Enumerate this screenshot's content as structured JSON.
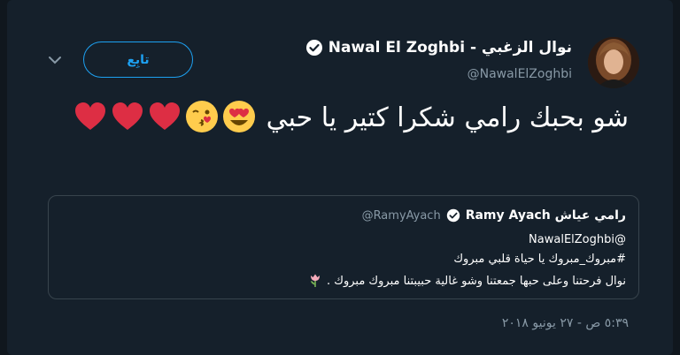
{
  "user": {
    "name": "Nawal El Zoghbi - نوال الزغبي",
    "handle": "@NawalElZoghbi",
    "verified": true
  },
  "follow_button": {
    "label": "تابِع"
  },
  "tweet": {
    "text": "شو بحبك رامي شكرا كتير يا حبي",
    "emojis": [
      "heart-eyes-face",
      "kissing-face",
      "red-heart",
      "red-heart",
      "red-heart"
    ]
  },
  "quote": {
    "name": "Ramy Ayach رامي عياش",
    "handle": "@RamyAyach",
    "verified": true,
    "mention": "@NawalElZoghbi",
    "hashtag_line": "#مبروك_مبروك يا حياة قلبي مبروك",
    "body": "نوال فرحتنا وعلى حبها جمعتنا وشو غالية حبيبتنا مبروك مبروك .",
    "emoji": "tulip"
  },
  "timestamp": "٥:٣٩ ص - ٢٧ يونيو ٢٠١٨",
  "colors": {
    "background": "#10171e",
    "card": "#15202b",
    "accent": "#1da1f2",
    "muted": "#8899a6",
    "border": "#38444d"
  }
}
